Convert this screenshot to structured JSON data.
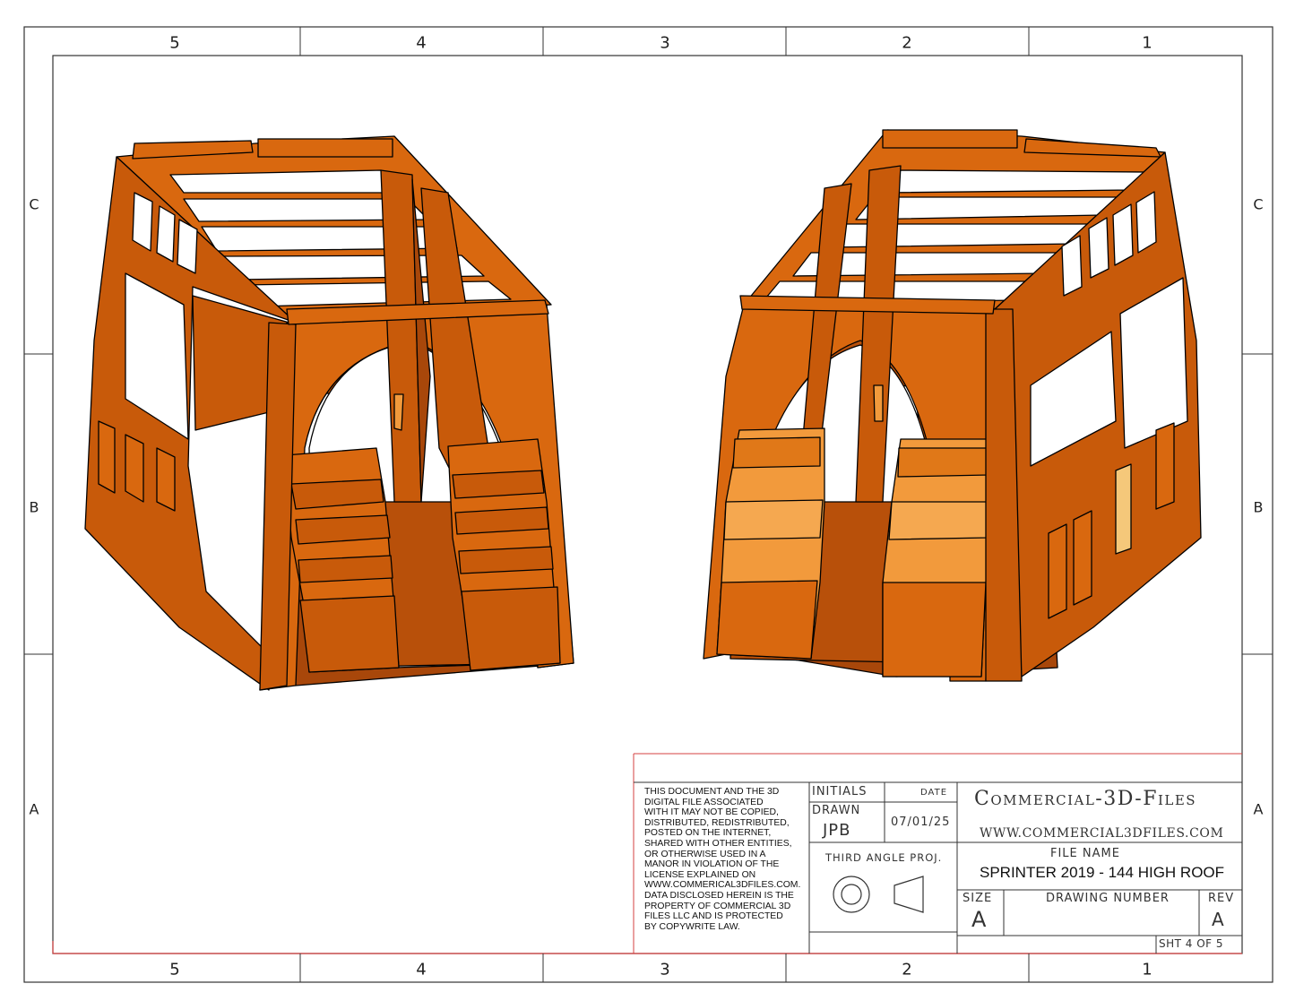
{
  "border": {
    "columns_top": [
      "5",
      "4",
      "3",
      "2",
      "1"
    ],
    "columns_bottom": [
      "5",
      "4",
      "3",
      "2",
      "1"
    ],
    "rows_left": [
      "C",
      "B",
      "A"
    ],
    "rows_right": [
      "C",
      "B",
      "A"
    ]
  },
  "title_block": {
    "legal_lines": [
      "THIS DOCUMENT AND THE 3D",
      "DIGITAL FILE ASSOCIATED",
      "WITH IT MAY NOT BE COPIED,",
      "DISTRIBUTED, REDISTRIBUTED,",
      "POSTED ON THE INTERNET,",
      "SHARED WITH OTHER ENTITIES,",
      "OR OTHERWISE USED IN A",
      "MANOR IN VIOLATION OF THE",
      "LICENSE EXPLAINED ON",
      "WWW.COMMERICAL3DFILES.COM.",
      "DATA DISCLOSED HEREIN IS THE",
      "PROPERTY OF COMMERCIAL 3D",
      "FILES LLC AND IS PROTECTED",
      "BY COPYWRITE LAW."
    ],
    "initials_label": "INITIALS",
    "date_label": "DATE",
    "drawn_label": "DRAWN",
    "drawn_by": "JPB",
    "drawn_date": "07/01/25",
    "projection_label": "THIRD ANGLE PROJ.",
    "company": "Commercial-3D-Files",
    "website": "www.commercial3dfiles.com",
    "file_name_label": "FILE NAME",
    "file_name": "SPRINTER 2019 - 144 HIGH ROOF",
    "size_label": "SIZE",
    "size_value": "A",
    "drawing_number_label": "DRAWING NUMBER",
    "drawing_number": "",
    "rev_label": "REV",
    "rev_value": "A",
    "sheet": "SHT 4 OF 5"
  },
  "colors": {
    "body_orange": "#C85A0A",
    "body_mid": "#D9680F",
    "body_light": "#F29A3C",
    "body_dark": "#A8470A",
    "outline": "#000000",
    "border_red": "#D44040"
  },
  "views": [
    {
      "name": "van-interior-left-iso"
    },
    {
      "name": "van-interior-right-iso"
    }
  ]
}
